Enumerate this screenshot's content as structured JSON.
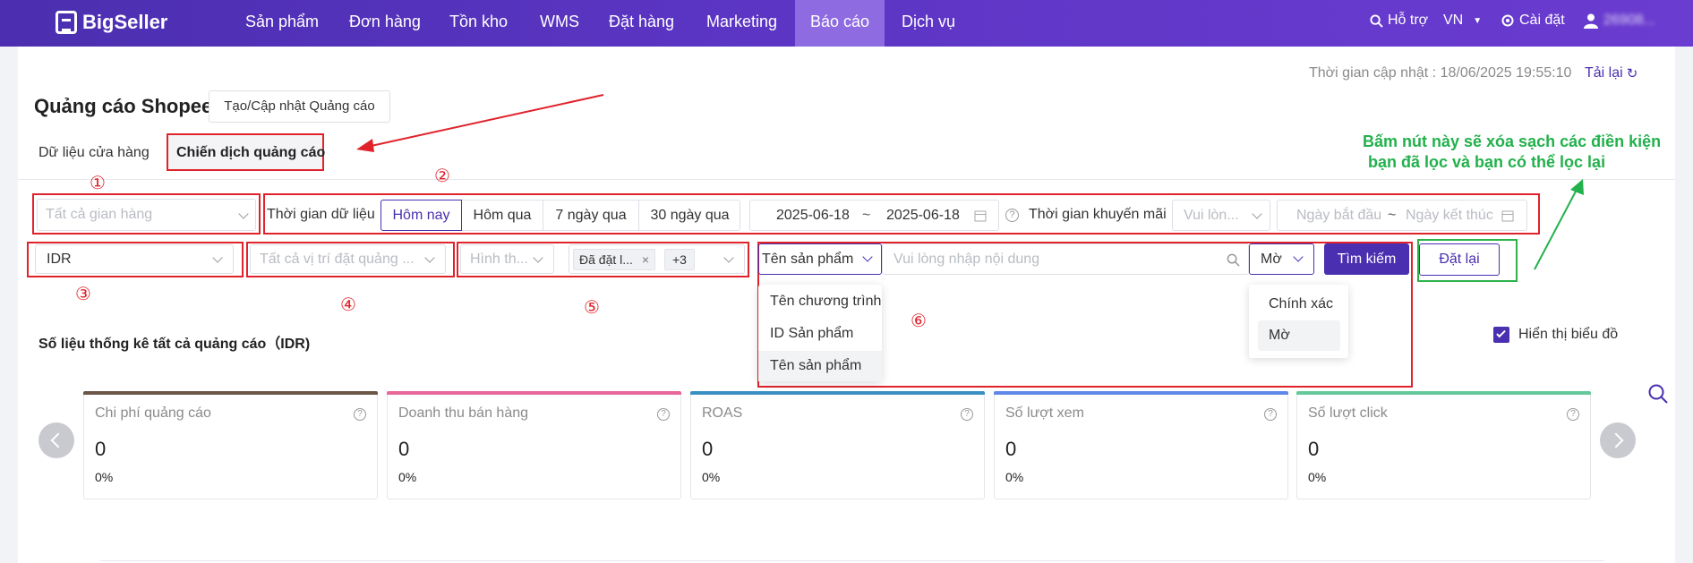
{
  "nav": {
    "logo": "BigSeller",
    "items": [
      "Sản phẩm",
      "Đơn hàng",
      "Tồn kho",
      "WMS",
      "Đặt hàng",
      "Marketing",
      "Báo cáo",
      "Dịch vụ"
    ],
    "support": "Hỗ trợ",
    "lang": "VN",
    "settings": "Cài đặt",
    "user": "26908..."
  },
  "header": {
    "update_time": "Thời gian cập nhật : 18/06/2025 19:55:10",
    "reload": "Tải lại",
    "title": "Quảng cáo Shopee",
    "create_button": "Tạo/Cập nhật Quảng cáo"
  },
  "tabs": [
    "Dữ liệu cửa hàng",
    "Chiến dịch quảng cáo"
  ],
  "filters": {
    "shop_placeholder": "Tất cả gian hàng",
    "data_time_label": "Thời gian dữ liệu",
    "time_options": [
      "Hôm nay",
      "Hôm qua",
      "7 ngày qua",
      "30 ngày qua"
    ],
    "date_start": "2025-06-18",
    "date_sep": "~",
    "date_end": "2025-06-18",
    "promo_time_label": "Thời gian khuyến mãi",
    "promo_select_placeholder": "Vui lòn...",
    "promo_start_placeholder": "Ngày bắt đầu",
    "promo_end_placeholder": "Ngày kết thúc",
    "currency": "IDR",
    "position_placeholder": "Tất cả vị trí đặt quảng ...",
    "type_placeholder": "Hình th...",
    "status_tag": "Đã đặt l...",
    "status_more": "+3",
    "search_field": "Tên sản phẩm",
    "search_placeholder": "Vui lòng nhập nội dung",
    "match_mode": "Mờ",
    "search_button": "Tìm kiếm",
    "reset_button": "Đặt lại"
  },
  "search_field_menu": [
    "Tên chương trình",
    "ID Sản phẩm",
    "Tên sản phẩm"
  ],
  "match_mode_menu": [
    "Chính xác",
    "Mờ"
  ],
  "annotations": {
    "numbers": [
      "①",
      "②",
      "③",
      "④",
      "⑤",
      "⑥"
    ],
    "note_line1": "Bấm nút này sẽ xóa sạch các điền kiện",
    "note_line2": "bạn đã lọc và bạn có thể lọc lại",
    "red": "#e0232b",
    "green": "#22b14c"
  },
  "stats": {
    "title": "Số liệu thống kê tất cả quảng cáo（IDR)",
    "show_chart_label": "Hiển thị biểu đồ",
    "show_chart_checked": true,
    "cards": [
      {
        "title": "Chi phí quảng cáo",
        "value": "0",
        "pct": "0%",
        "color": "#6b5648"
      },
      {
        "title": "Doanh thu bán hàng",
        "value": "0",
        "pct": "0%",
        "color": "#e8679a"
      },
      {
        "title": "ROAS",
        "value": "0",
        "pct": "0%",
        "color": "#3a8fc2"
      },
      {
        "title": "Số lượt xem",
        "value": "0",
        "pct": "0%",
        "color": "#5f87e8"
      },
      {
        "title": "Số lượt click",
        "value": "0",
        "pct": "0%",
        "color": "#64c99a"
      }
    ]
  },
  "colors": {
    "brand": "#4a2fb0",
    "nav_active": "#8e6be0"
  }
}
